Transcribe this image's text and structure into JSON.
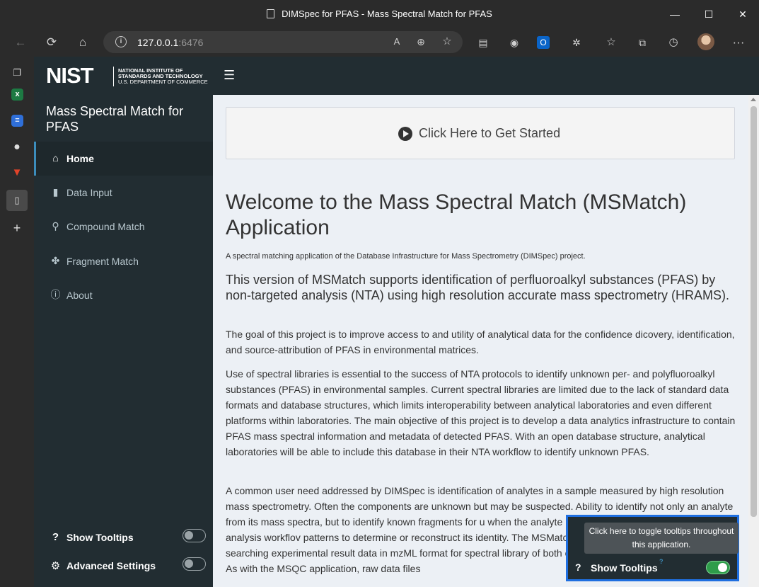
{
  "window": {
    "title": "DIMSpec for PFAS - Mass Spectral Match for PFAS",
    "minimize": "—",
    "maximize": "☐",
    "close": "✕"
  },
  "browser": {
    "url_host": "127.0.0.1",
    "url_port": ":6476",
    "back": "←",
    "reload": "⟳",
    "home": "⌂",
    "menu": "···"
  },
  "edge_sidebar": {
    "items": [
      "tabs-icon",
      "excel-icon",
      "docs-icon",
      "github-icon",
      "gitlab-icon",
      "page-icon",
      "add-icon"
    ]
  },
  "header": {
    "nist_logo": "NIST",
    "nist_line1": "NATIONAL INSTITUTE OF",
    "nist_line2": "STANDARDS AND TECHNOLOGY",
    "nist_line3": "U.S. DEPARTMENT OF COMMERCE"
  },
  "sidebar": {
    "title": "Mass Spectral Match for PFAS",
    "items": [
      {
        "label": "Home",
        "icon": "home-icon"
      },
      {
        "label": "Data Input",
        "icon": "file-icon"
      },
      {
        "label": "Compound Match",
        "icon": "search-icon"
      },
      {
        "label": "Fragment Match",
        "icon": "puzzle-icon"
      },
      {
        "label": "About",
        "icon": "info-icon"
      }
    ],
    "show_tooltips": "Show Tooltips",
    "advanced_settings": "Advanced Settings"
  },
  "main": {
    "get_started": "Click Here to Get Started",
    "heading": "Welcome to the Mass Spectral Match (MSMatch) Application",
    "subtitle": "A spectral matching application of the Database Infrastructure for Mass Spectrometry (DIMSpec) project.",
    "h3": "This version of MSMatch supports identification of perfluoroalkyl substances (PFAS) by non-targeted analysis (NTA) using high resolution accurate mass spectrometry (HRAMS).",
    "p1": "The goal of this project is to improve access to and utility of analytical data for the confidence dicovery, identification, and source-attribution of PFAS in environmental matrices.",
    "p2": "Use of spectral libraries is essential to the success of NTA protocols to identify unknown per- and polyfluoroalkyl substances (PFAS) in environmental samples. Current spectral libraries are limited due to the lack of standard data formats and database structures, which limits interoperability between analytical laboratories and even different platforms within laboratories. The main objective of this project is to develop a data analytics infrastructure to contain PFAS mass spectral information and metadata of detected PFAS. With an open database structure, analytical laboratories will be able to include this database in their NTA workflow to identify unknown PFAS.",
    "p3": "A common user need addressed by DIMSpec is identification of analytes in a sample measured by high resolution mass spectrometry. Often the components are unknown but may be suspected. Ability to identify not only an analyte from its mass spectra, but to identify known fragments for u when the analyte itself cannot be identified, non-targeted analysis workflov patterns to determine or reconstruct its identity. The MSMatch application v analysis projects by searching experimental result data in mzML format for spectral library of both compounds and annotated fragments. As with the MSQC application, raw data files"
  },
  "tooltip": {
    "text": "Click here to toggle tooltips throughout this application.",
    "label": "Show Tooltips",
    "sup": "?"
  }
}
